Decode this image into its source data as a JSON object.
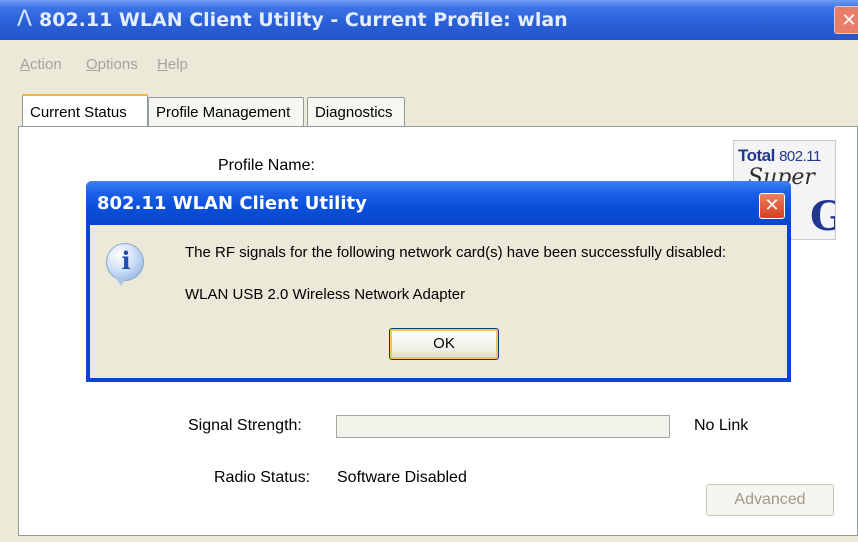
{
  "window": {
    "title": "802.11 WLAN Client Utility - Current Profile: wlan",
    "close_symbol": "✕",
    "app_icon": "Λ"
  },
  "menu": [
    {
      "underline": "A",
      "rest": "ction"
    },
    {
      "underline": "O",
      "rest": "ptions"
    },
    {
      "underline": "H",
      "rest": "elp"
    }
  ],
  "tabs": [
    {
      "label": "Current Status",
      "active": true
    },
    {
      "label": "Profile Management",
      "active": false
    },
    {
      "label": "Diagnostics",
      "active": false
    }
  ],
  "status": {
    "profile_name_label": "Profile Name:",
    "signal_strength_label": "Signal Strength:",
    "signal_strength_value": "No Link",
    "signal_strength_level": 0,
    "radio_status_label": "Radio Status:",
    "radio_status_value": "Software Disabled",
    "advanced_button": "Advanced"
  },
  "logo": {
    "brand": "Total",
    "standard": "802.11",
    "line2": "Super",
    "line3": "G"
  },
  "dialog": {
    "title": "802.11 WLAN Client Utility",
    "close_symbol": "✕",
    "icon": "i",
    "message": "The RF signals for the following network card(s) have been successfully disabled:",
    "adapter": "WLAN USB 2.0 Wireless Network Adapter",
    "ok_button": "OK"
  },
  "colors": {
    "titlebar": "#2a60d8",
    "dialog_frame": "#0844d8",
    "close_button": "#d4421f",
    "window_bg": "#ece9d8",
    "tab_active_highlight": "#f8b33a"
  }
}
